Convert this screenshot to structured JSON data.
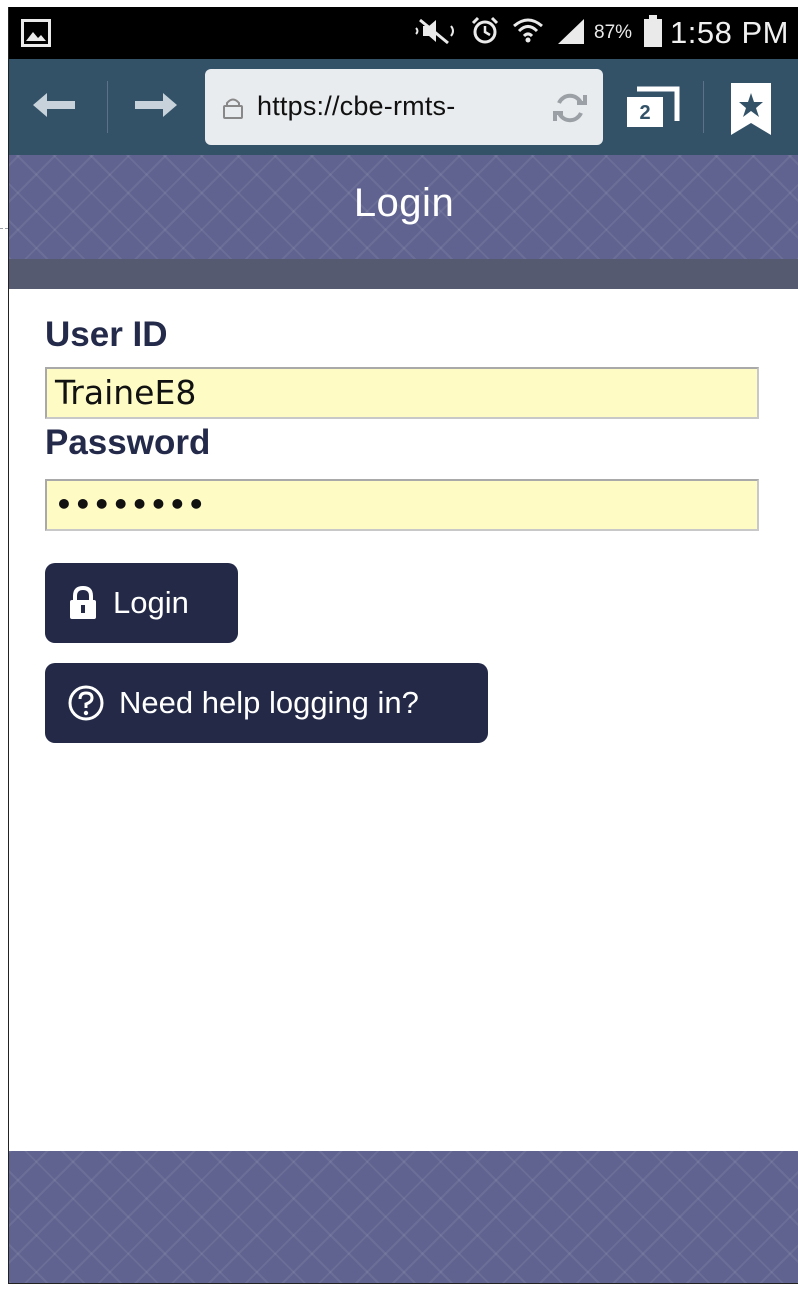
{
  "status_bar": {
    "battery_percent": "87%",
    "time": "1:58 PM",
    "icons": [
      "gallery-icon",
      "mute-icon",
      "alarm-icon",
      "wifi-icon",
      "signal-icon",
      "battery-icon"
    ]
  },
  "browser": {
    "url": "https://cbe-rmts-",
    "tab_count": "2",
    "icons": [
      "back-arrow-icon",
      "forward-arrow-icon",
      "lock-icon",
      "reload-icon",
      "tabs-icon",
      "bookmark-star-icon"
    ]
  },
  "page": {
    "title": "Login"
  },
  "form": {
    "user_id_label": "User ID",
    "user_id_value": "TraineE8",
    "password_label": "Password",
    "password_value": "••••••••",
    "login_button": "Login",
    "help_button": "Need help logging in?"
  },
  "colors": {
    "toolbar": "#335268",
    "header": "#60638f",
    "header_stripe": "#555a70",
    "button": "#232946",
    "input_bg": "#fffbc5",
    "label": "#242a4a"
  }
}
